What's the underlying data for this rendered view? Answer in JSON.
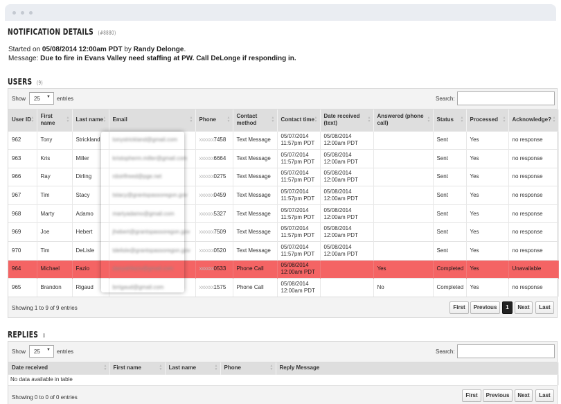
{
  "page": {
    "title": "NOTIFICATION DETAILS",
    "id_label": "(#8880)",
    "started_prefix": "Started on ",
    "started_date": "05/08/2014 12:00am PDT",
    "started_by_word": " by ",
    "started_by": "Randy Delonge",
    "started_suffix": ".",
    "message_prefix": "Message: ",
    "message_text": "Due to fire in Evans Valley need staffing at PW. Call DeLonge if responding in."
  },
  "users": {
    "title": "USERS",
    "count": "(9)",
    "show_label": "Show",
    "entries_label": "entries",
    "page_size": "25",
    "search_label": "Search:",
    "columns": [
      "User ID",
      "First name",
      "Last name",
      "Email",
      "Phone",
      "Contact method",
      "Contact time",
      "Date received (text)",
      "Answered (phone call)",
      "Status",
      "Processed",
      "Acknowledge?"
    ],
    "rows": [
      {
        "id": "962",
        "first": "Tony",
        "last": "Strickland",
        "email": "tonystrickland@gmail.com",
        "phone_mask": "xxxxxx",
        "phone": "7458",
        "method": "Text Message",
        "contact_date": "05/07/2014",
        "contact_time": "11:57pm PDT",
        "recv_date": "05/08/2014",
        "recv_time": "12:00am PDT",
        "answered": "",
        "status": "Sent",
        "processed": "Yes",
        "ack": "no response"
      },
      {
        "id": "963",
        "first": "Kris",
        "last": "Miller",
        "email": "kristopherm.miller@gmail.com",
        "phone_mask": "xxxxxx",
        "phone": "6664",
        "method": "Text Message",
        "contact_date": "05/07/2014",
        "contact_time": "11:57pm PDT",
        "recv_date": "05/08/2014",
        "recv_time": "12:00am PDT",
        "answered": "",
        "status": "Sent",
        "processed": "Yes",
        "ack": "no response"
      },
      {
        "id": "966",
        "first": "Ray",
        "last": "Dirling",
        "email": "rdoirlfreed@pge.net",
        "phone_mask": "xxxxxx",
        "phone": "0275",
        "method": "Text Message",
        "contact_date": "05/07/2014",
        "contact_time": "11:57pm PDT",
        "recv_date": "05/08/2014",
        "recv_time": "12:00am PDT",
        "answered": "",
        "status": "Sent",
        "processed": "Yes",
        "ack": "no response"
      },
      {
        "id": "967",
        "first": "Tim",
        "last": "Stacy",
        "email": "tstacy@grantspassoregon.gov",
        "phone_mask": "xxxxxx",
        "phone": "0459",
        "method": "Text Message",
        "contact_date": "05/07/2014",
        "contact_time": "11:57pm PDT",
        "recv_date": "05/08/2014",
        "recv_time": "12:00am PDT",
        "answered": "",
        "status": "Sent",
        "processed": "Yes",
        "ack": "no response"
      },
      {
        "id": "968",
        "first": "Marty",
        "last": "Adamo",
        "email": "martyadamo@gmail.com",
        "phone_mask": "xxxxxx",
        "phone": "5327",
        "method": "Text Message",
        "contact_date": "05/07/2014",
        "contact_time": "11:57pm PDT",
        "recv_date": "05/08/2014",
        "recv_time": "12:00am PDT",
        "answered": "",
        "status": "Sent",
        "processed": "Yes",
        "ack": "no response"
      },
      {
        "id": "969",
        "first": "Joe",
        "last": "Hebert",
        "email": "jhebert@grantspassoregon.gov",
        "phone_mask": "xxxxxx",
        "phone": "7509",
        "method": "Text Message",
        "contact_date": "05/07/2014",
        "contact_time": "11:57pm PDT",
        "recv_date": "05/08/2014",
        "recv_time": "12:00am PDT",
        "answered": "",
        "status": "Sent",
        "processed": "Yes",
        "ack": "no response"
      },
      {
        "id": "970",
        "first": "Tim",
        "last": "DeLisle",
        "email": "tdelisle@grantspassoregon.gov",
        "phone_mask": "xxxxxx",
        "phone": "0520",
        "method": "Text Message",
        "contact_date": "05/07/2014",
        "contact_time": "11:57pm PDT",
        "recv_date": "05/08/2014",
        "recv_time": "12:00am PDT",
        "answered": "",
        "status": "Sent",
        "processed": "Yes",
        "ack": "no response"
      },
      {
        "id": "964",
        "first": "Michael",
        "last": "Fazio",
        "email": "danyahfazio@gmail.com",
        "phone_mask": "xxxxxx",
        "phone": "0533",
        "method": "Phone Call",
        "contact_date": "05/08/2014",
        "contact_time": "12:00am PDT",
        "recv_date": "",
        "recv_time": "",
        "answered": "Yes",
        "status": "Completed",
        "processed": "Yes",
        "ack": "Unavailable",
        "highlight": true
      },
      {
        "id": "965",
        "first": "Brandon",
        "last": "Rigaud",
        "email": "brrigaud@gmail.com",
        "phone_mask": "xxxxxx",
        "phone": "1575",
        "method": "Phone Call",
        "contact_date": "05/08/2014",
        "contact_time": "12:00am PDT",
        "recv_date": "",
        "recv_time": "",
        "answered": "No",
        "status": "Completed",
        "processed": "Yes",
        "ack": "no response"
      }
    ],
    "footer_info": "Showing 1 to 9 of 9 entries",
    "pagination": {
      "first": "First",
      "previous": "Previous",
      "current": "1",
      "next": "Next",
      "last": "Last"
    }
  },
  "replies": {
    "title": "REPLIES",
    "count": "0",
    "show_label": "Show",
    "entries_label": "entries",
    "page_size": "25",
    "search_label": "Search:",
    "columns": [
      "Date received",
      "First name",
      "Last name",
      "Phone",
      "Reply Message"
    ],
    "empty_text": "No data available in table",
    "footer_info": "Showing 0 to 0 of 0 entries",
    "pagination": {
      "first": "First",
      "previous": "Previous",
      "next": "Next",
      "last": "Last"
    }
  },
  "colors": {
    "highlight_row": "#f46464",
    "header_bg": "#dedede",
    "toolbar_bg": "#f3f3f3",
    "active_page": "#222222"
  }
}
